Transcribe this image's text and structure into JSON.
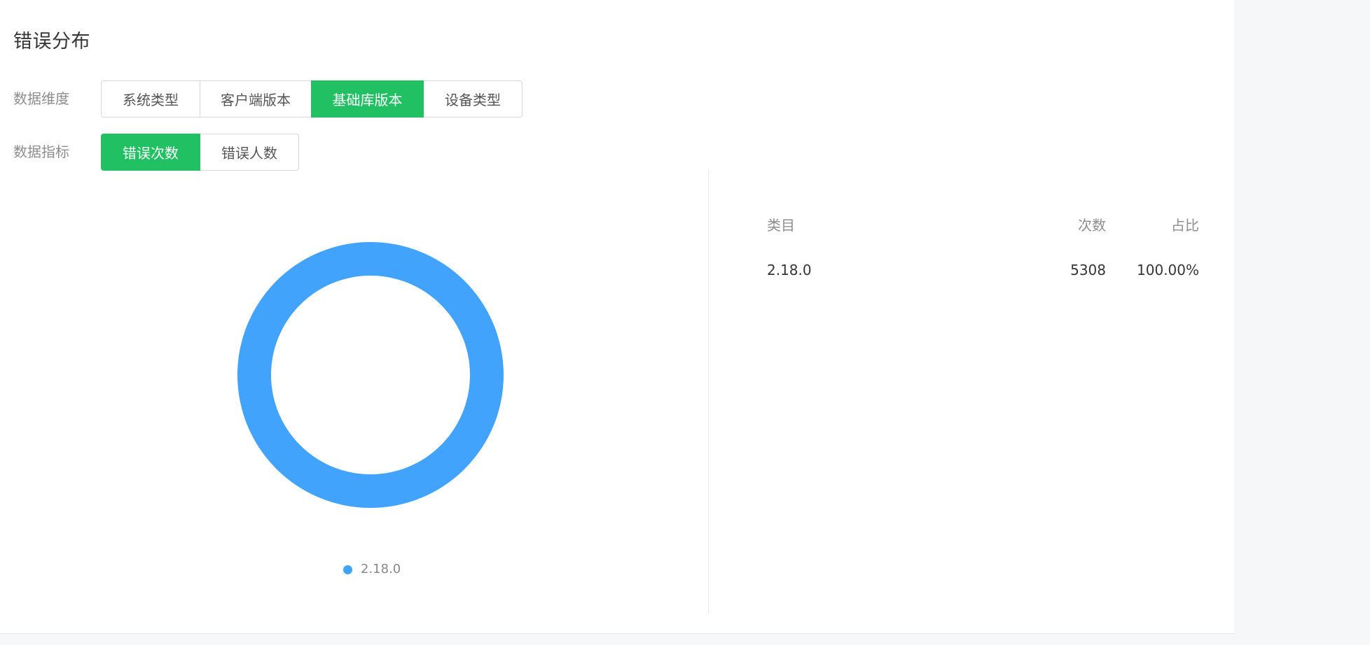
{
  "section": {
    "title": "错误分布"
  },
  "dimension": {
    "label": "数据维度",
    "options": [
      "系统类型",
      "客户端版本",
      "基础库版本",
      "设备类型"
    ],
    "selected_index": 2
  },
  "metric": {
    "label": "数据指标",
    "options": [
      "错误次数",
      "错误人数"
    ],
    "selected_index": 0
  },
  "colors": {
    "accent_green": "#21c063",
    "series_blue": "#41a3fc"
  },
  "chart_data": {
    "type": "pie",
    "variant": "donut",
    "categories": [
      "2.18.0"
    ],
    "values": [
      5308
    ],
    "legend_position": "bottom"
  },
  "table": {
    "headers": {
      "category": "类目",
      "count": "次数",
      "ratio": "占比"
    },
    "rows": [
      {
        "category": "2.18.0",
        "count": "5308",
        "ratio": "100.00%"
      }
    ]
  }
}
